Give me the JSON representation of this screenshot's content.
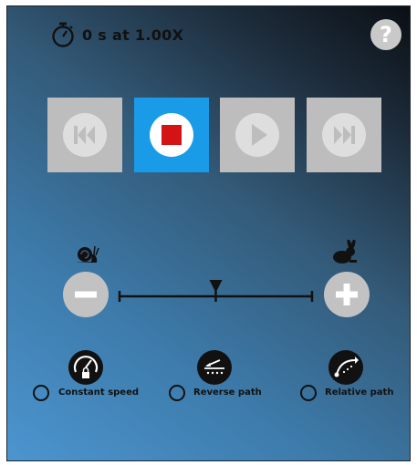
{
  "header": {
    "timer_text": "0 s at 1.00X",
    "timer_icon": "stopwatch-icon",
    "help_label": "?"
  },
  "transport": {
    "buttons": [
      {
        "name": "skip-to-start",
        "icon": "skip-back-icon",
        "active": false
      },
      {
        "name": "stop",
        "icon": "stop-icon",
        "active": true
      },
      {
        "name": "play",
        "icon": "play-icon",
        "active": false
      },
      {
        "name": "skip-to-end",
        "icon": "skip-forward-icon",
        "active": false
      }
    ]
  },
  "speed": {
    "slow_icon": "snail-icon",
    "fast_icon": "rabbit-icon",
    "decrease_icon": "minus-icon",
    "increase_icon": "plus-icon",
    "slider_position": 0.5
  },
  "options": [
    {
      "label": "Constant speed",
      "icon": "speedometer-lock-icon",
      "selected": false
    },
    {
      "label": "Reverse path",
      "icon": "reverse-path-icon",
      "selected": false
    },
    {
      "label": "Relative path",
      "icon": "relative-path-icon",
      "selected": false
    }
  ],
  "colors": {
    "active_button": "#1a9be8",
    "inactive_button": "#bdbdbd",
    "stop_square": "#d41414"
  }
}
